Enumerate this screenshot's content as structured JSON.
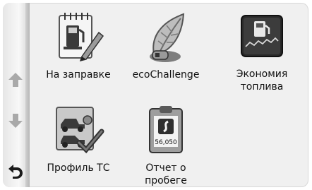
{
  "nav": {
    "up_icon": "arrow-up-icon",
    "down_icon": "arrow-down-icon",
    "back_icon": "back-arrow-icon"
  },
  "tiles": [
    {
      "label": "На заправке",
      "icon": "fuel-log-icon"
    },
    {
      "label": "ecoChallenge",
      "icon": "leaf-icon"
    },
    {
      "label": "Экономия топлива",
      "label_line1": "Экономия",
      "label_line2": "топлива",
      "icon": "fuel-economy-icon"
    },
    {
      "label": "Профиль ТС",
      "icon": "vehicle-profile-icon"
    },
    {
      "label": "Отчет о пробеге",
      "icon": "mileage-report-icon",
      "odometer": "56,050"
    }
  ]
}
